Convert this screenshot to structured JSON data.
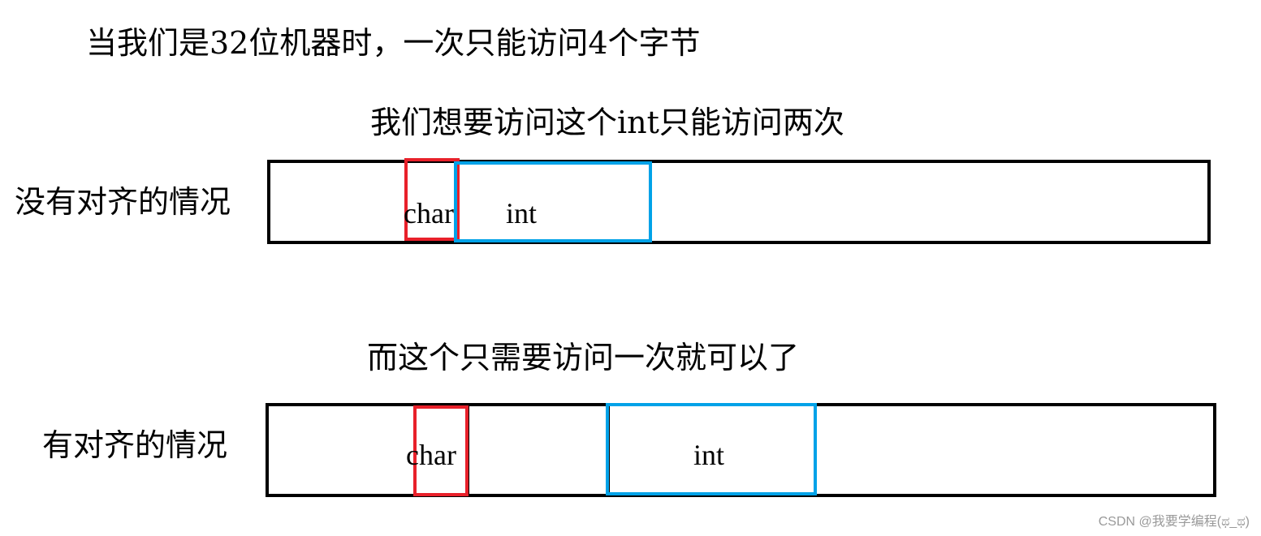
{
  "title": "当我们是32位机器时，一次只能访问4个字节",
  "unaligned": {
    "caption": "我们想要访问这个int只能访问两次",
    "label": "没有对齐的情况",
    "char_label": "char",
    "int_label": "int"
  },
  "aligned": {
    "caption": "而这个只需要访问一次就可以了",
    "label": "有对齐的情况",
    "char_label": "char",
    "int_label": "int"
  },
  "colors": {
    "char_box": "#e8202a",
    "int_box": "#00a2e8",
    "memory": "#000000"
  },
  "watermark": "CSDN @我要学编程(ಥ_ಥ)"
}
